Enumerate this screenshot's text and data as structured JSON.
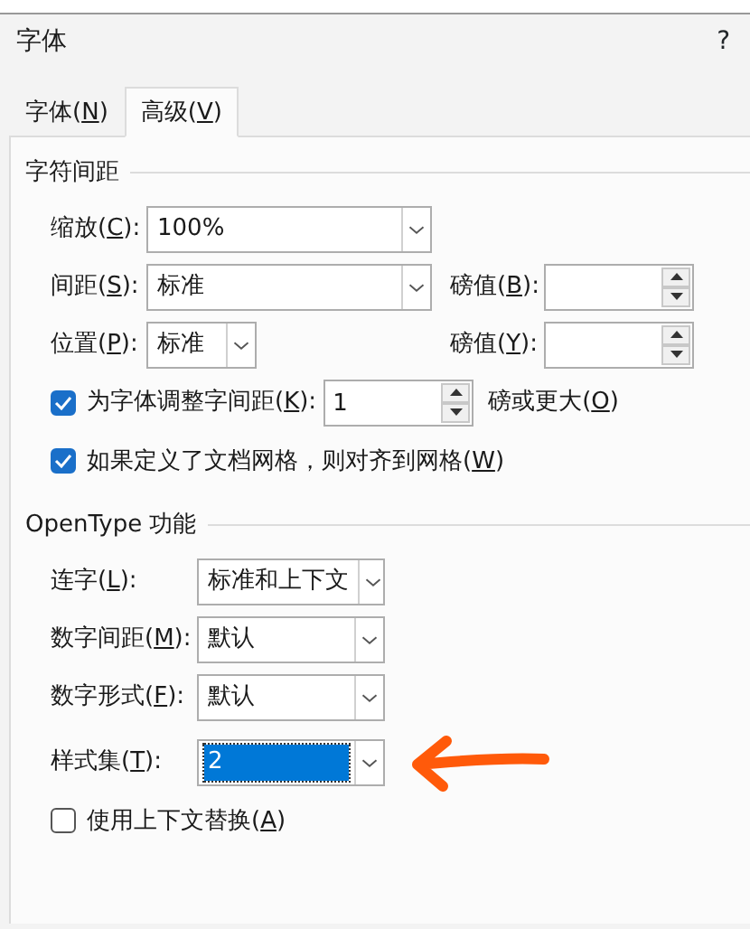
{
  "window": {
    "title": "字体",
    "help": "?"
  },
  "tabs": [
    {
      "label": "字体(N)",
      "selected": false
    },
    {
      "label": "高级(V)",
      "selected": true
    }
  ],
  "character_spacing": {
    "title": "字符间距",
    "scale": {
      "label": "缩放(C):",
      "value": "100%"
    },
    "spacing": {
      "label": "间距(S):",
      "value": "标准",
      "points_label": "磅值(B):"
    },
    "position": {
      "label": "位置(P):",
      "value": "标准",
      "points_label": "磅值(Y):"
    },
    "kerning": {
      "label": "为字体调整字间距(K):",
      "checked": true,
      "value": "1",
      "suffix": "磅或更大(O)"
    },
    "snap_to_grid": {
      "label": "如果定义了文档网格，则对齐到网格(W)",
      "checked": true
    }
  },
  "opentype": {
    "title": "OpenType 功能",
    "fields": [
      {
        "label": "连字(L):",
        "value": "标准和上下文",
        "selected": false
      },
      {
        "label": "数字间距(M):",
        "value": "默认",
        "selected": false
      },
      {
        "label": "数字形式(F):",
        "value": "默认",
        "selected": false
      },
      {
        "label": "样式集(T):",
        "value": "2",
        "selected": true
      }
    ],
    "contextual_alternates": {
      "label": "使用上下文替换(A)",
      "checked": false
    }
  }
}
